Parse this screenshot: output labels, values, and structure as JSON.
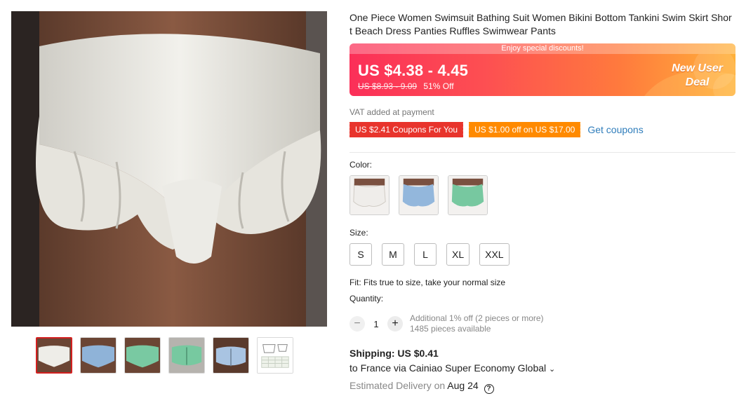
{
  "product": {
    "title": "One Piece Women Swimsuit Bathing Suit Women Bikini Bottom Tankini Swim Skirt Short Beach Dress Panties Ruffles Swimwear Pants"
  },
  "gallery": {
    "main_image": "white-ruffle-skirt-photo",
    "thumbnails": [
      {
        "name": "white"
      },
      {
        "name": "blue"
      },
      {
        "name": "green"
      },
      {
        "name": "green-back"
      },
      {
        "name": "blue-back"
      },
      {
        "name": "size-chart"
      }
    ]
  },
  "price": {
    "discount_strip": "Enjoy special discounts!",
    "current": "US $4.38 - 4.45",
    "original": "US $8.93 - 9.09",
    "off": "51% Off",
    "badge_line1": "New User",
    "badge_line2": "Deal"
  },
  "vat": "VAT added at payment",
  "coupons": {
    "coupon1": "US $2.41 Coupons For You",
    "coupon2": "US $1.00 off on US $17.00",
    "link": "Get coupons"
  },
  "color": {
    "label": "Color:",
    "options": [
      "white",
      "blue",
      "green"
    ]
  },
  "size": {
    "label": "Size:",
    "options": [
      "S",
      "M",
      "L",
      "XL",
      "XXL"
    ]
  },
  "fit": "Fit: Fits true to size, take your normal size",
  "quantity": {
    "label": "Quantity:",
    "minus": "−",
    "value": "1",
    "plus": "+",
    "info1": "Additional 1% off (2 pieces or more)",
    "info2": "1485 pieces available"
  },
  "shipping": {
    "title": "Shipping: US $0.41",
    "destination": "to France via Cainiao Super Economy Global",
    "chevron": "⌄",
    "delivery_label": "Estimated Delivery on",
    "delivery_date": "Aug 24",
    "help": "?"
  },
  "colors": {
    "accent_red": "#e8342c",
    "coupon_orange": "#ff8a00",
    "link_blue": "#2f7dbb"
  }
}
